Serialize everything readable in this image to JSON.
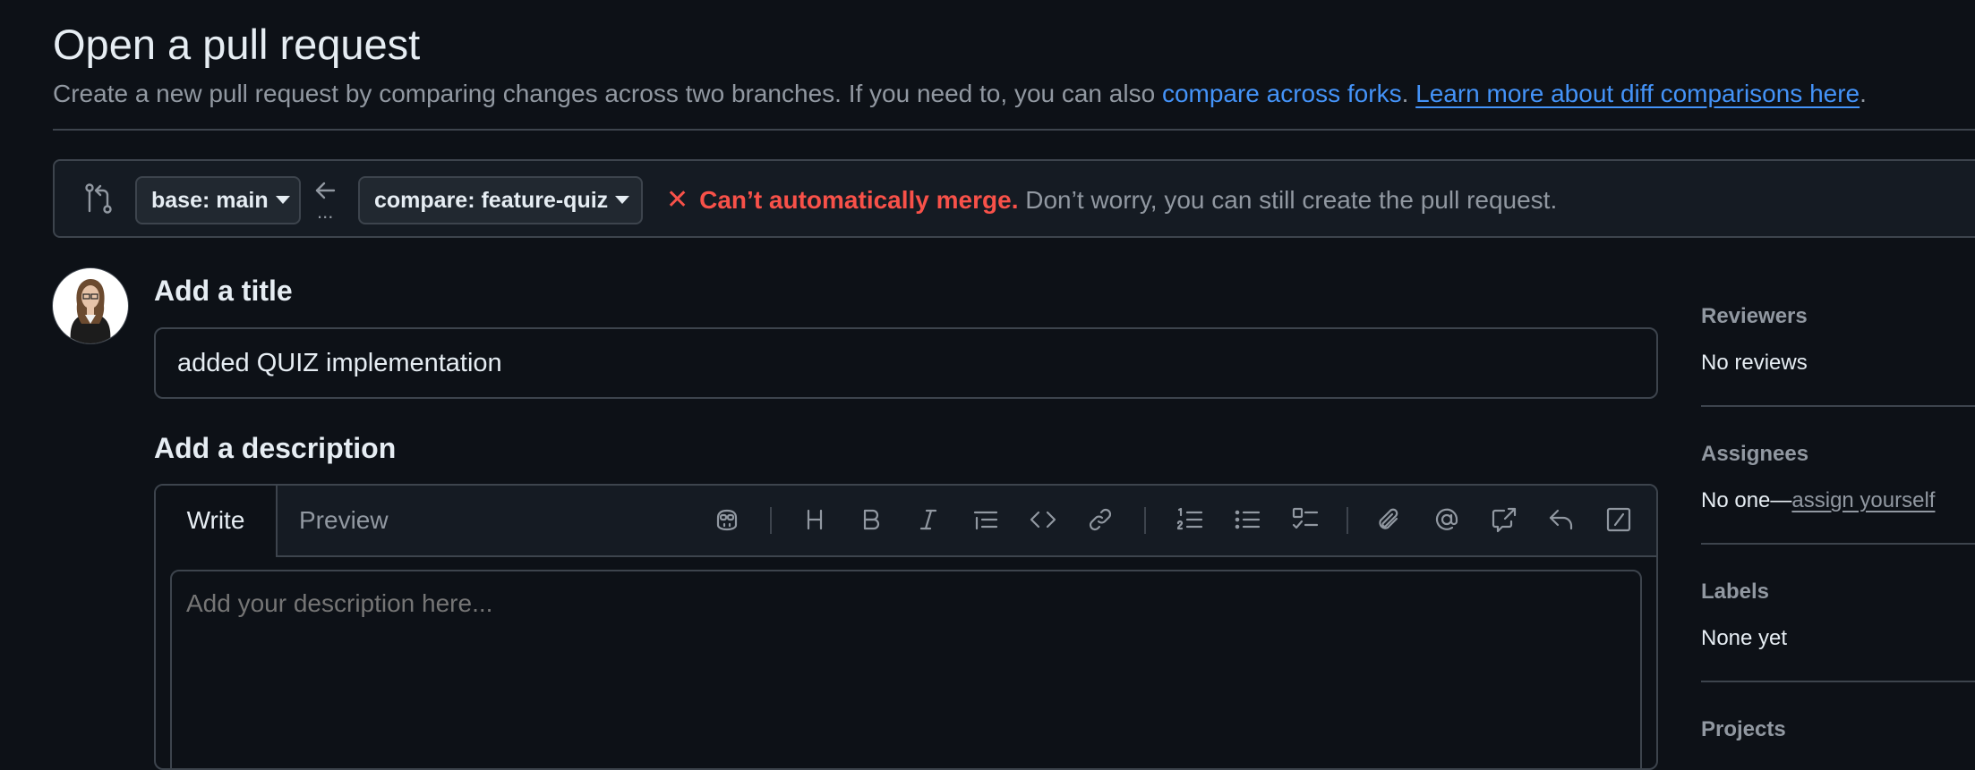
{
  "header": {
    "title": "Open a pull request",
    "subtitle_text": "Create a new pull request by comparing changes across two branches. If you need to, you can also ",
    "compare_forks_link": "compare across forks",
    "subtitle_period1": ".",
    "learn_more_link": "Learn more about diff comparisons here",
    "subtitle_period2": "."
  },
  "compare": {
    "base_label": "base: main",
    "compare_label": "compare: feature-quiz",
    "dots": "...",
    "merge_error": "Can’t automatically merge.",
    "merge_message": " Don’t worry, you can still create the pull request."
  },
  "form": {
    "title_label": "Add a title",
    "title_value": "added QUIZ implementation",
    "description_label": "Add a description",
    "tab_write": "Write",
    "tab_preview": "Preview",
    "description_placeholder": "Add your description here...",
    "toolbar_icons": [
      "copilot-icon",
      "heading-icon",
      "bold-icon",
      "italic-icon",
      "quote-icon",
      "code-icon",
      "link-icon",
      "ordered-list-icon",
      "unordered-list-icon",
      "task-list-icon",
      "attach-icon",
      "mention-icon",
      "cross-reference-icon",
      "reply-icon",
      "slash-command-icon"
    ]
  },
  "sidebar": {
    "reviewers_label": "Reviewers",
    "reviewers_value": "No reviews",
    "assignees_label": "Assignees",
    "assignees_value": "No one—",
    "assign_yourself_link": "assign yourself",
    "labels_label": "Labels",
    "labels_value": "None yet",
    "projects_label": "Projects"
  },
  "colors": {
    "background": "#0d1117",
    "link": "#4493f8",
    "error": "#f85149",
    "muted_text": "#9198a1",
    "border": "#3d444d"
  }
}
